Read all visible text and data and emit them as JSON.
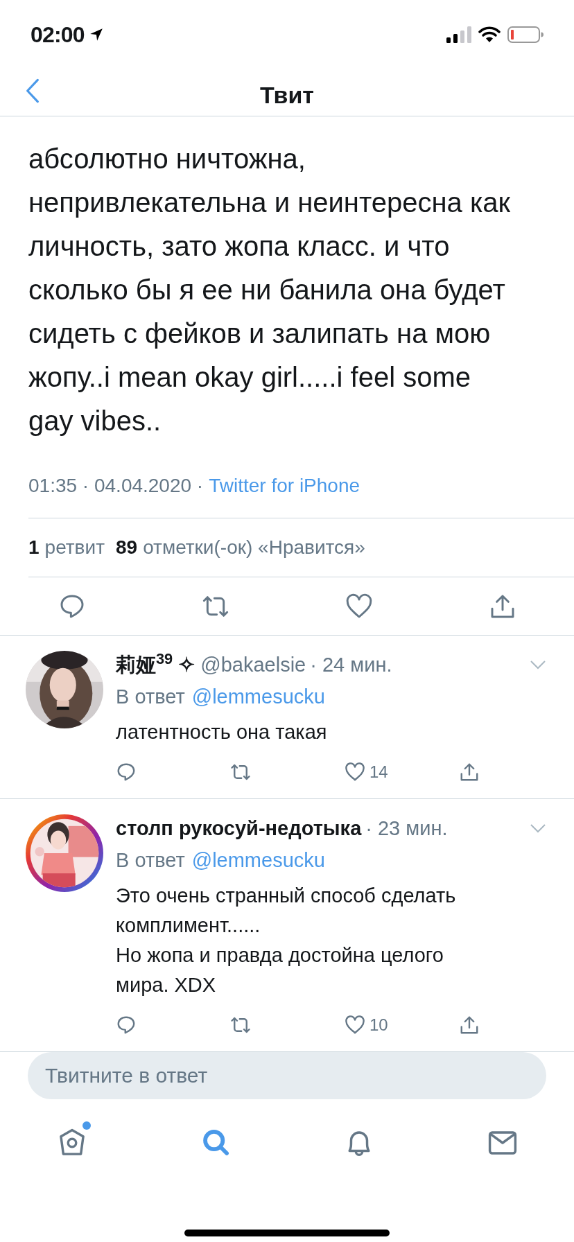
{
  "status_bar": {
    "time": "02:00"
  },
  "nav": {
    "title": "Твит"
  },
  "tweet": {
    "text": "абсолютно ничтожна, непривлекательна и неинтересна как личность, зато жопа класс. и что сколько бы я ее ни банила она будет сидеть с фейков и залипать на мою жопу..i mean okay girl.....i feel some gay vibes..",
    "timestamp": "01:35 · 04.04.2020 ·",
    "source": "Twitter for iPhone",
    "retweets": {
      "count": "1",
      "label": "ретвит"
    },
    "likes": {
      "count": "89",
      "label": "отметки(-ок) «Нравится»"
    }
  },
  "replies": [
    {
      "name": "莉娅$^{39}$ ✧",
      "handle": "@bakaelsie",
      "time": "· 24 мин.",
      "reply_label": "В ответ",
      "reply_to": "@lemmesucku",
      "text": "латентность она такая",
      "like_count": "14"
    },
    {
      "name": "столп рукосуй-недотыка",
      "time": "· 23 мин.",
      "reply_label": "В ответ",
      "reply_to": "@lemmesucku",
      "text": "Это очень странный способ сделать комплимент......\nНо жопа и правда достойна целого мира. XDX",
      "like_count": "10"
    }
  ],
  "reply_field": {
    "placeholder": "Твитните в ответ"
  },
  "tab_bar": [
    {
      "kind": "home",
      "selected": false,
      "unread": true
    },
    {
      "kind": "search",
      "selected": true,
      "unread": false
    },
    {
      "kind": "notifications",
      "selected": false,
      "unread": false
    },
    {
      "kind": "messages",
      "selected": false,
      "unread": false
    }
  ]
}
